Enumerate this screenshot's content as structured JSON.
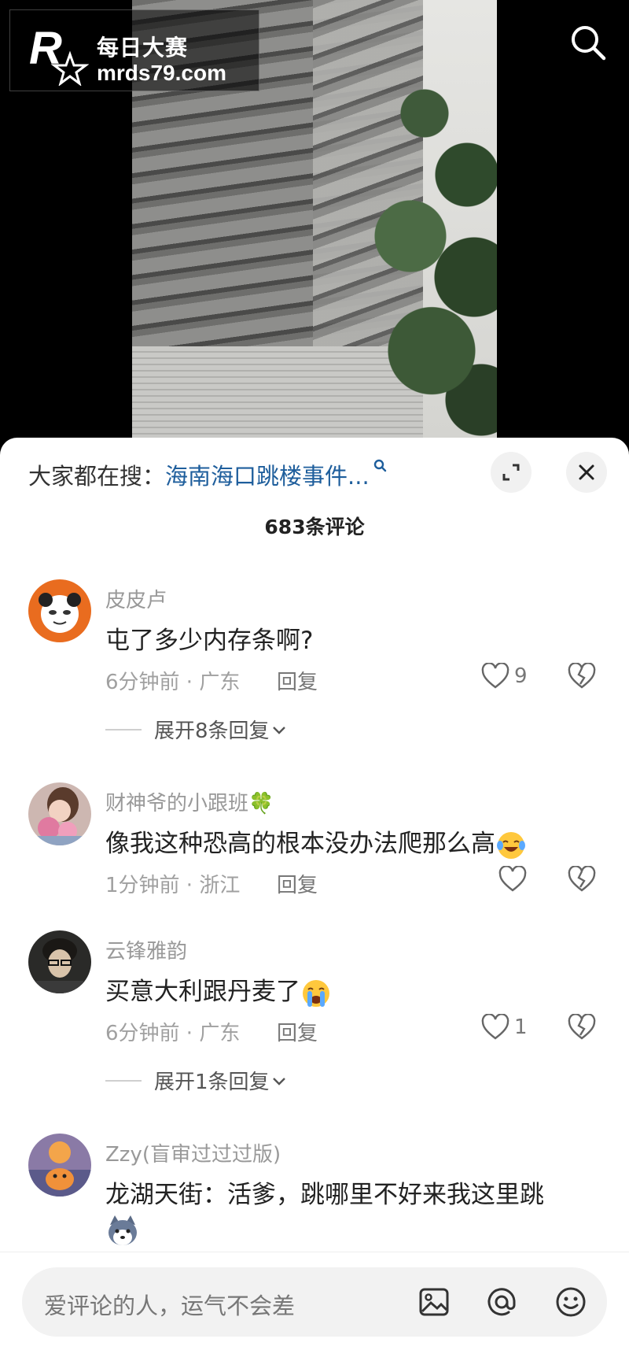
{
  "watermark": {
    "title": "每日大赛",
    "url": "mrds79.com",
    "logo_letter": "R",
    "logo_small": "每日大赛"
  },
  "sheet": {
    "hot_search_prefix": "大家都在搜：",
    "hot_search_term": "海南海口跳楼事件...",
    "comment_count": "683条评论"
  },
  "comments": [
    {
      "name": "皮皮卢",
      "text": "屯了多少内存条啊?",
      "meta": "6分钟前 · 广东",
      "reply": "回复",
      "likes": "9",
      "expand": "展开8条回复"
    },
    {
      "name": "财神爷的小跟班🍀",
      "text": "像我这种恐高的根本没办法爬那么高",
      "meta": "1分钟前 · 浙江",
      "reply": "回复",
      "likes": ""
    },
    {
      "name": "云锋雅韵",
      "text": "买意大利跟丹麦了",
      "meta": "6分钟前 · 广东",
      "reply": "回复",
      "likes": "1",
      "expand": "展开1条回复"
    },
    {
      "name": "Zzy(盲审过过过版)",
      "text": "龙湖天街：活爹，跳哪里不好来我这里跳"
    }
  ],
  "input": {
    "placeholder": "爱评论的人，运气不会差"
  },
  "icons": [
    "search-icon",
    "expand-icon",
    "close-icon",
    "heart-icon",
    "broken-heart-icon",
    "image-icon",
    "at-icon",
    "smiley-icon"
  ]
}
